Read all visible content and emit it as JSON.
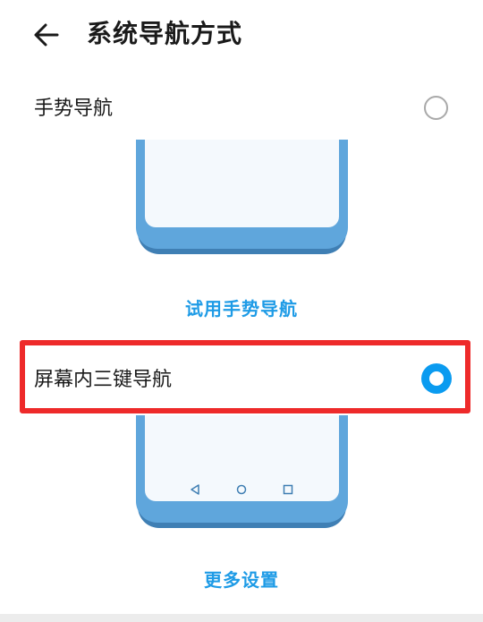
{
  "header": {
    "back_icon": "arrow-left-icon",
    "title": "系统导航方式"
  },
  "options": [
    {
      "label": "手势导航",
      "selected": false,
      "action_label": "试用手势导航"
    },
    {
      "label": "屏幕内三键导航",
      "selected": true,
      "action_label": "更多设置"
    }
  ],
  "nav_keys": [
    "back-triangle-icon",
    "home-circle-icon",
    "recents-square-icon"
  ],
  "colors": {
    "accent": "#1e9be6",
    "radio_selected": "#0a9bf0",
    "phone": "#5fa6dc",
    "highlight": "#ee2a2a"
  }
}
